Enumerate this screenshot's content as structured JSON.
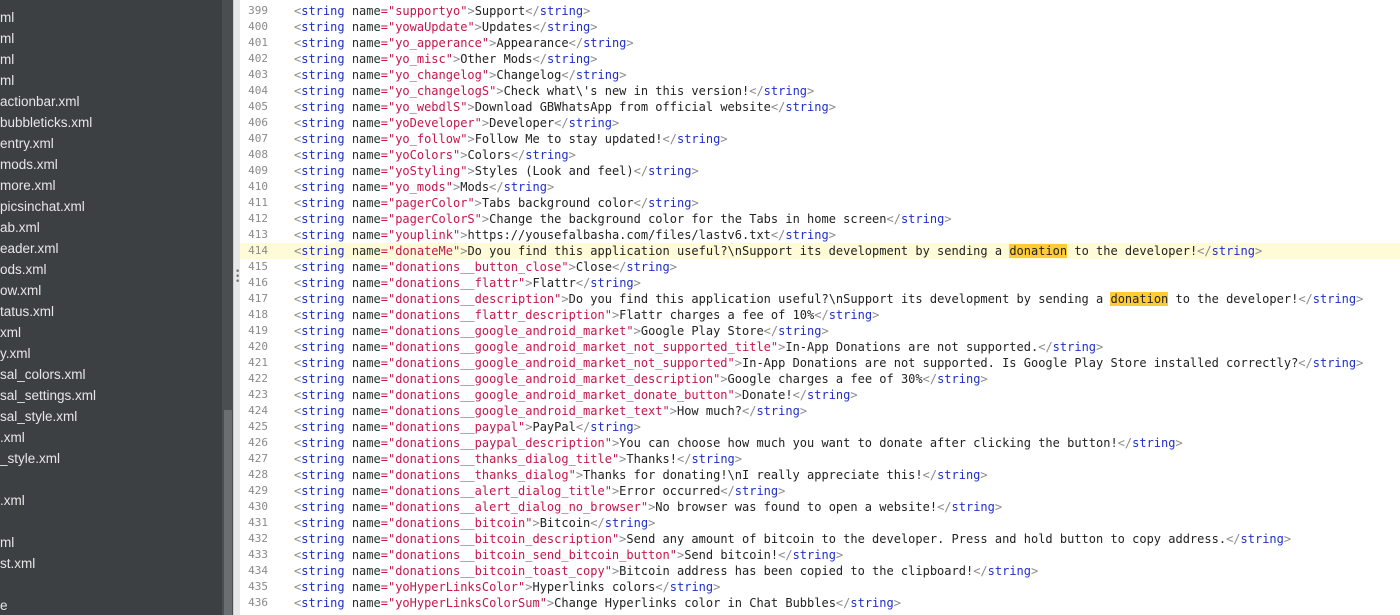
{
  "sidebar": {
    "files": [
      "ml",
      "ml",
      "ml",
      "ml",
      "actionbar.xml",
      "bubbleticks.xml",
      "entry.xml",
      "mods.xml",
      "more.xml",
      "picsinchat.xml",
      "ab.xml",
      "eader.xml",
      "ods.xml",
      "ow.xml",
      "tatus.xml",
      "xml",
      "y.xml",
      "sal_colors.xml",
      "sal_settings.xml",
      "sal_style.xml",
      ".xml",
      "_style.xml",
      "",
      ".xml",
      "",
      "ml",
      "st.xml",
      "",
      "e"
    ]
  },
  "editor": {
    "current_line": 414,
    "highlight_term": "donation",
    "lines": [
      {
        "num": 399,
        "name": "supportyo",
        "text": "Support"
      },
      {
        "num": 400,
        "name": "yowaUpdate",
        "text": "Updates"
      },
      {
        "num": 401,
        "name": "yo_apperance",
        "text": "Appearance"
      },
      {
        "num": 402,
        "name": "yo_misc",
        "text": "Other Mods"
      },
      {
        "num": 403,
        "name": "yo_changelog",
        "text": "Changelog"
      },
      {
        "num": 404,
        "name": "yo_changelogS",
        "text": "Check what\\'s new in this version!"
      },
      {
        "num": 405,
        "name": "yo_webdlS",
        "text": "Download GBWhatsApp from official website"
      },
      {
        "num": 406,
        "name": "yoDeveloper",
        "text": "Developer"
      },
      {
        "num": 407,
        "name": "yo_follow",
        "text": "Follow Me to stay updated!"
      },
      {
        "num": 408,
        "name": "yoColors",
        "text": "Colors"
      },
      {
        "num": 409,
        "name": "yoStyling",
        "text": "Styles (Look and feel)"
      },
      {
        "num": 410,
        "name": "yo_mods",
        "text": "Mods"
      },
      {
        "num": 411,
        "name": "pagerColor",
        "text": "Tabs background color"
      },
      {
        "num": 412,
        "name": "pagerColorS",
        "text": "Change the background color for the Tabs in home screen"
      },
      {
        "num": 413,
        "name": "youplink",
        "text": "https://yousefalbasha.com/files/lastv6.txt"
      },
      {
        "num": 414,
        "name": "donateMe",
        "text_before": "Do you find this application useful?\\nSupport its development by sending a ",
        "hl_a": "dona",
        "hl_b": "tion",
        "text_after": " to the developer!"
      },
      {
        "num": 415,
        "name": "donations__button_close",
        "text": "Close"
      },
      {
        "num": 416,
        "name": "donations__flattr",
        "text": "Flattr"
      },
      {
        "num": 417,
        "name": "donations__description",
        "text_before": "Do you find this application useful?\\nSupport its development by sending a ",
        "hl": "donation",
        "text_after": " to the developer!"
      },
      {
        "num": 418,
        "name": "donations__flattr_description",
        "text": "Flattr charges a fee of 10%"
      },
      {
        "num": 419,
        "name": "donations__google_android_market",
        "text": "Google Play Store"
      },
      {
        "num": 420,
        "name": "donations__google_android_market_not_supported_title",
        "text": "In-App Donations are not supported."
      },
      {
        "num": 421,
        "name": "donations__google_android_market_not_supported",
        "text": "In-App Donations are not supported. Is Google Play Store installed correctly?"
      },
      {
        "num": 422,
        "name": "donations__google_android_market_description",
        "text": "Google charges a fee of 30%"
      },
      {
        "num": 423,
        "name": "donations__google_android_market_donate_button",
        "text": "Donate!"
      },
      {
        "num": 424,
        "name": "donations__google_android_market_text",
        "text": "How much?"
      },
      {
        "num": 425,
        "name": "donations__paypal",
        "text": "PayPal"
      },
      {
        "num": 426,
        "name": "donations__paypal_description",
        "text": "You can choose how much you want to donate after clicking the button!"
      },
      {
        "num": 427,
        "name": "donations__thanks_dialog_title",
        "text": "Thanks!"
      },
      {
        "num": 428,
        "name": "donations__thanks_dialog",
        "text": "Thanks for donating!\\nI really appreciate this!"
      },
      {
        "num": 429,
        "name": "donations__alert_dialog_title",
        "text": "Error occurred"
      },
      {
        "num": 430,
        "name": "donations__alert_dialog_no_browser",
        "text": "No browser was found to open a website!"
      },
      {
        "num": 431,
        "name": "donations__bitcoin",
        "text": "Bitcoin"
      },
      {
        "num": 432,
        "name": "donations__bitcoin_description",
        "text": "Send any amount of bitcoin to the developer. Press and hold button to copy address."
      },
      {
        "num": 433,
        "name": "donations__bitcoin_send_bitcoin_button",
        "text": "Send bitcoin!"
      },
      {
        "num": 434,
        "name": "donations__bitcoin_toast_copy",
        "text": "Bitcoin address has been copied to the clipboard!"
      },
      {
        "num": 435,
        "name": "yoHyperLinksColor",
        "text": "Hyperlinks colors"
      },
      {
        "num": 436,
        "name": "yoHyperLinksColorSum",
        "text": "Change Hyperlinks color in Chat Bubbles"
      }
    ]
  },
  "syntax": {
    "tag": "string",
    "attr": "name",
    "open_bracket": "<",
    "close_open": "</",
    "end_bracket": ">",
    "equals_quote": "=\""
  }
}
